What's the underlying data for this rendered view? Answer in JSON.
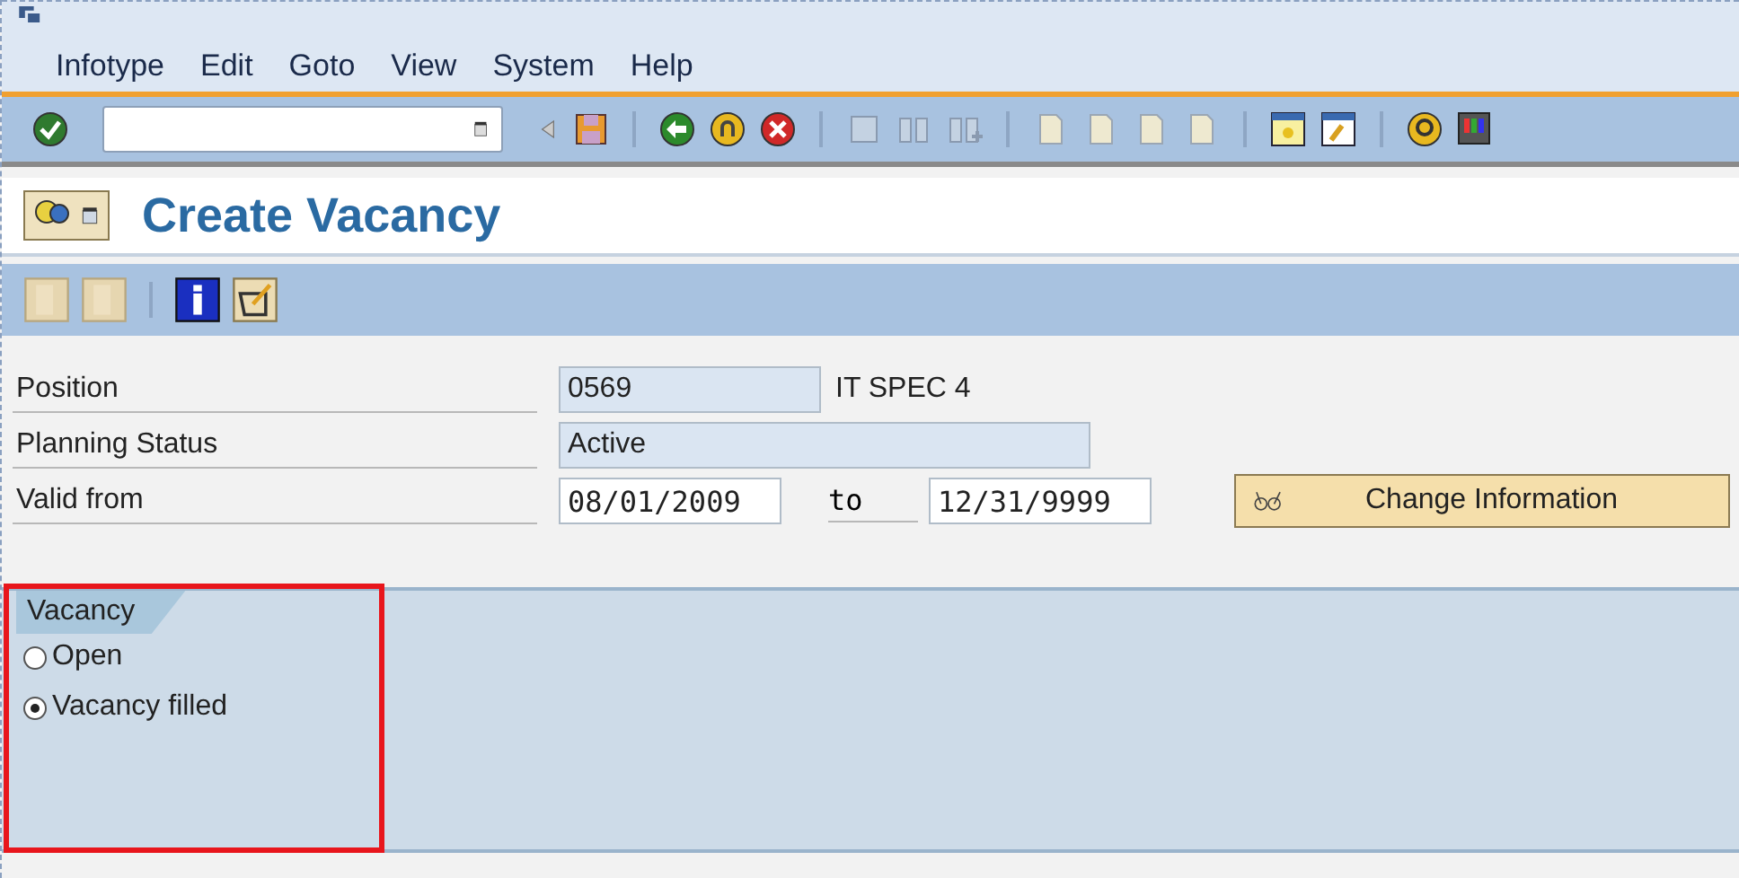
{
  "menu": [
    "Infotype",
    "Edit",
    "Goto",
    "View",
    "System",
    "Help"
  ],
  "title": "Create Vacancy",
  "form": {
    "position": {
      "label": "Position",
      "value": "0569",
      "text": "IT SPEC 4"
    },
    "planning_status": {
      "label": "Planning Status",
      "value": "Active"
    },
    "validity": {
      "label": "Valid from",
      "from": "08/01/2009",
      "to_label": "to",
      "to": "12/31/9999"
    },
    "change_button": "Change Information"
  },
  "group": {
    "title": "Vacancy",
    "options": [
      {
        "label": "Open",
        "selected": false
      },
      {
        "label": "Vacancy filled",
        "selected": true
      }
    ]
  }
}
